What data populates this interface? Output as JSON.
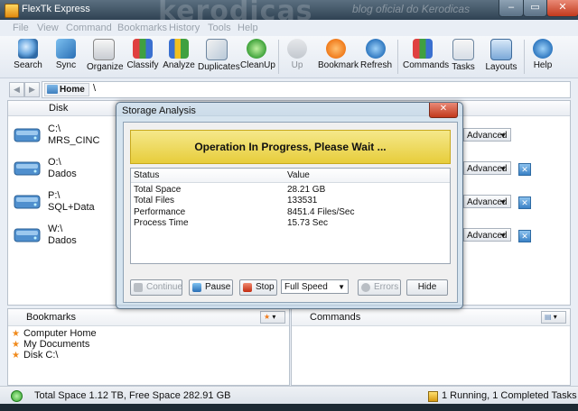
{
  "window": {
    "title": "FlexTk Express",
    "watermark": "kerodicas",
    "watermark_sub": "blog oficial do Kerodicas"
  },
  "menu": [
    "File",
    "View",
    "Command",
    "Bookmarks",
    "History",
    "Tools",
    "Help"
  ],
  "toolbar": [
    {
      "label": "Search",
      "icon": "search-icon"
    },
    {
      "label": "Sync",
      "icon": "sync-icon"
    },
    {
      "label": "Organize",
      "icon": "organize-icon"
    },
    {
      "label": "Classify",
      "icon": "classify-icon"
    },
    {
      "label": "Analyze",
      "icon": "analyze-icon"
    },
    {
      "label": "Duplicates",
      "icon": "duplicates-icon"
    },
    {
      "label": "CleanUp",
      "icon": "cleanup-icon"
    },
    {
      "label": "Up",
      "icon": "up-arrow-icon",
      "disabled": true
    },
    {
      "label": "Bookmark",
      "icon": "bookmark-star-icon"
    },
    {
      "label": "Refresh",
      "icon": "refresh-icon"
    },
    {
      "label": "Commands",
      "icon": "commands-icon"
    },
    {
      "label": "Tasks",
      "icon": "tasks-icon"
    },
    {
      "label": "Layouts",
      "icon": "layouts-icon"
    },
    {
      "label": "Help",
      "icon": "help-icon"
    }
  ],
  "address": {
    "home": "Home",
    "path": "\\"
  },
  "disk_panel": {
    "header": {
      "disk": "Disk"
    },
    "disks": [
      {
        "name": "C:\\",
        "label": "MRS_CINC",
        "mode": "Advanced",
        "removable": false
      },
      {
        "name": "O:\\",
        "label": "Dados",
        "mode": "Advanced",
        "removable": true
      },
      {
        "name": "P:\\",
        "label": "SQL+Data",
        "mode": "Advanced",
        "removable": true
      },
      {
        "name": "W:\\",
        "label": "Dados",
        "mode": "Advanced",
        "removable": true
      }
    ]
  },
  "dialog": {
    "title": "Storage Analysis",
    "banner": "Operation In Progress, Please Wait ...",
    "columns": {
      "status": "Status",
      "value": "Value"
    },
    "rows": [
      {
        "status": "Total Space",
        "value": "28.21 GB"
      },
      {
        "status": "Total Files",
        "value": "133531"
      },
      {
        "status": "Performance",
        "value": "8451.4 Files/Sec"
      },
      {
        "status": "Process Time",
        "value": "15.73 Sec"
      }
    ],
    "buttons": {
      "continue": "Continue",
      "pause": "Pause",
      "stop": "Stop",
      "speed": "Full Speed",
      "errors": "Errors",
      "hide": "Hide"
    }
  },
  "bookmarks": {
    "title": "Bookmarks",
    "items": [
      "Computer Home",
      "My Documents",
      "Disk C:\\"
    ]
  },
  "commands": {
    "title": "Commands"
  },
  "status": {
    "left": "Total Space 1.12 TB, Free Space 282.91 GB",
    "right": "1 Running, 1 Completed Tasks"
  }
}
